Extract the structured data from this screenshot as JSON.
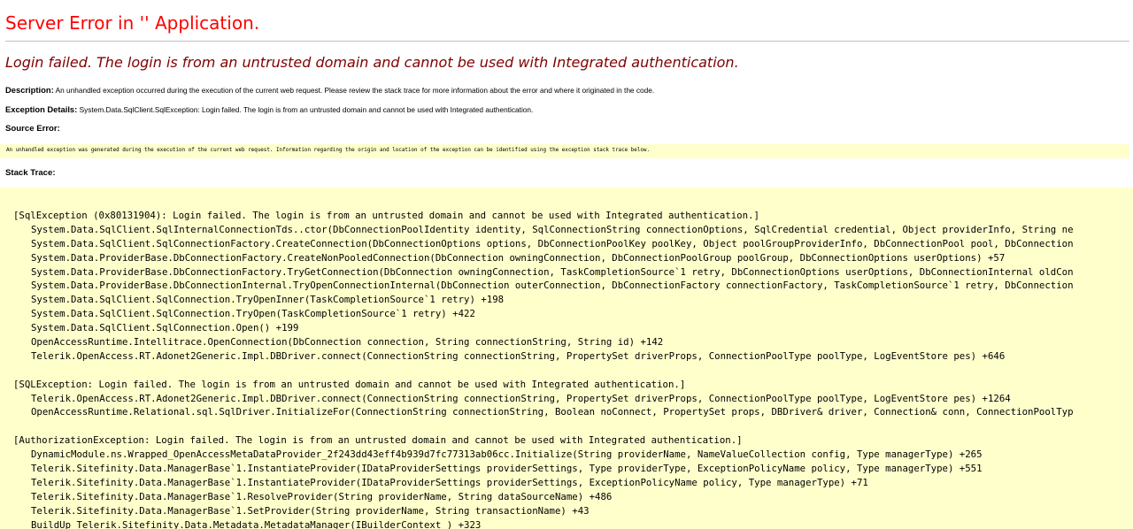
{
  "page_title": "Server Error in '' Application.",
  "error_heading": "Login failed. The login is from an untrusted domain and cannot be used with Integrated authentication.",
  "description": {
    "label": "Description:",
    "text": "An unhandled exception occurred during the execution of the current web request. Please review the stack trace for more information about the error and where it originated in the code."
  },
  "exception_details": {
    "label": "Exception Details:",
    "text": "System.Data.SqlClient.SqlException: Login failed. The login is from an untrusted domain and cannot be used with Integrated authentication."
  },
  "source_error": {
    "label": "Source Error:",
    "text": "An unhandled exception was generated during the execution of the current web request. Information regarding the origin and location of the exception can be identified using the exception stack trace below."
  },
  "stack_trace": {
    "label": "Stack Trace:",
    "blocks": [
      {
        "header": "[SqlException (0x80131904): Login failed. The login is from an untrusted domain and cannot be used with Integrated authentication.]",
        "frames": [
          "System.Data.SqlClient.SqlInternalConnectionTds..ctor(DbConnectionPoolIdentity identity, SqlConnectionString connectionOptions, SqlCredential credential, Object providerInfo, String ne",
          "System.Data.SqlClient.SqlConnectionFactory.CreateConnection(DbConnectionOptions options, DbConnectionPoolKey poolKey, Object poolGroupProviderInfo, DbConnectionPool pool, DbConnection",
          "System.Data.ProviderBase.DbConnectionFactory.CreateNonPooledConnection(DbConnection owningConnection, DbConnectionPoolGroup poolGroup, DbConnectionOptions userOptions) +57",
          "System.Data.ProviderBase.DbConnectionFactory.TryGetConnection(DbConnection owningConnection, TaskCompletionSource`1 retry, DbConnectionOptions userOptions, DbConnectionInternal oldCon",
          "System.Data.ProviderBase.DbConnectionInternal.TryOpenConnectionInternal(DbConnection outerConnection, DbConnectionFactory connectionFactory, TaskCompletionSource`1 retry, DbConnection",
          "System.Data.SqlClient.SqlConnection.TryOpenInner(TaskCompletionSource`1 retry) +198",
          "System.Data.SqlClient.SqlConnection.TryOpen(TaskCompletionSource`1 retry) +422",
          "System.Data.SqlClient.SqlConnection.Open() +199",
          "OpenAccessRuntime.Intellitrace.OpenConnection(DbConnection connection, String connectionString, String id) +142",
          "Telerik.OpenAccess.RT.Adonet2Generic.Impl.DBDriver.connect(ConnectionString connectionString, PropertySet driverProps, ConnectionPoolType poolType, LogEventStore pes) +646"
        ]
      },
      {
        "header": "[SQLException: Login failed. The login is from an untrusted domain and cannot be used with Integrated authentication.]",
        "frames": [
          "Telerik.OpenAccess.RT.Adonet2Generic.Impl.DBDriver.connect(ConnectionString connectionString, PropertySet driverProps, ConnectionPoolType poolType, LogEventStore pes) +1264",
          "OpenAccessRuntime.Relational.sql.SqlDriver.InitializeFor(ConnectionString connectionString, Boolean noConnect, PropertySet props, DBDriver& driver, Connection& conn, ConnectionPoolTyp"
        ]
      },
      {
        "header": "[AuthorizationException: Login failed. The login is from an untrusted domain and cannot be used with Integrated authentication.]",
        "frames": [
          "DynamicModule.ns.Wrapped_OpenAccessMetaDataProvider_2f243dd43eff4b939d7fc77313ab06cc.Initialize(String providerName, NameValueCollection config, Type managerType) +265",
          "Telerik.Sitefinity.Data.ManagerBase`1.InstantiateProvider(IDataProviderSettings providerSettings, Type providerType, ExceptionPolicyName policy, Type managerType) +551",
          "Telerik.Sitefinity.Data.ManagerBase`1.InstantiateProvider(IDataProviderSettings providerSettings, ExceptionPolicyName policy, Type managerType) +71",
          "Telerik.Sitefinity.Data.ManagerBase`1.ResolveProvider(String providerName, String dataSourceName) +486",
          "Telerik.Sitefinity.Data.ManagerBase`1.SetProvider(String providerName, String transactionName) +43",
          "BuildUp_Telerik.Sitefinity.Data.Metadata.MetadataManager(IBuilderContext ) +323"
        ]
      }
    ]
  }
}
